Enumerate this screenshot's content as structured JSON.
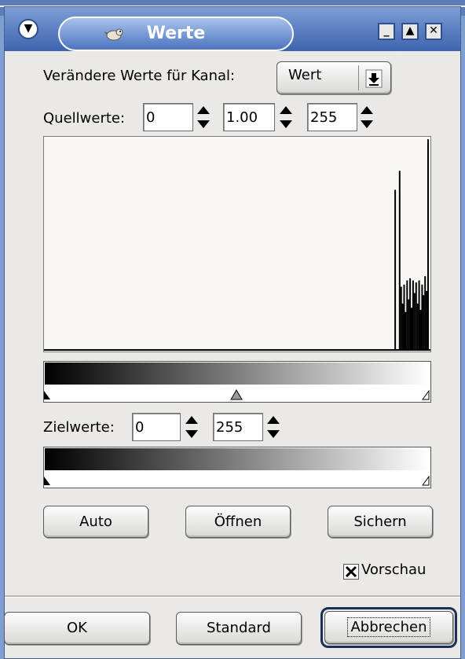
{
  "window": {
    "title": "Werte",
    "menu_icon": "chevron-down-icon",
    "app_icon": "gimp-wilber-icon",
    "minimize_icon": "minimize-icon",
    "maximize_icon": "maximize-icon",
    "close_icon": "close-icon"
  },
  "channel": {
    "label": "Verändere Werte für Kanal:",
    "selected": "Wert"
  },
  "input_levels": {
    "label": "Quellwerte:",
    "low": "0",
    "gamma": "1.00",
    "high": "255",
    "low_slider": 0,
    "gamma_slider": 1.0,
    "high_slider": 255
  },
  "output_levels": {
    "label": "Zielwerte:",
    "low": "0",
    "high": "255",
    "low_slider": 0,
    "high_slider": 255
  },
  "histogram": {
    "bins": [
      {
        "bin": 233,
        "value": 0.76
      },
      {
        "bin": 236,
        "value": 0.85
      },
      {
        "bin": 237,
        "value": 0.3
      },
      {
        "bin": 238,
        "value": 0.22
      },
      {
        "bin": 239,
        "value": 0.31
      },
      {
        "bin": 240,
        "value": 0.18
      },
      {
        "bin": 241,
        "value": 0.33
      },
      {
        "bin": 242,
        "value": 0.24
      },
      {
        "bin": 243,
        "value": 0.34
      },
      {
        "bin": 244,
        "value": 0.2
      },
      {
        "bin": 245,
        "value": 0.33
      },
      {
        "bin": 246,
        "value": 0.27
      },
      {
        "bin": 247,
        "value": 0.32
      },
      {
        "bin": 248,
        "value": 0.22
      },
      {
        "bin": 249,
        "value": 0.33
      },
      {
        "bin": 250,
        "value": 0.19
      },
      {
        "bin": 251,
        "value": 0.31
      },
      {
        "bin": 252,
        "value": 0.26
      },
      {
        "bin": 253,
        "value": 0.35
      },
      {
        "bin": 254,
        "value": 0.28
      },
      {
        "bin": 255,
        "value": 1.0
      }
    ]
  },
  "buttons": {
    "auto": "Auto",
    "open": "Öffnen",
    "save": "Sichern",
    "ok": "OK",
    "reset": "Standard",
    "cancel": "Abbrechen"
  },
  "preview": {
    "label": "Vorschau",
    "checked": true
  },
  "colors": {
    "titlebar": "#4c74bf",
    "dialog_bg": "#eae9e6",
    "desktop": "#7f9fd0"
  }
}
